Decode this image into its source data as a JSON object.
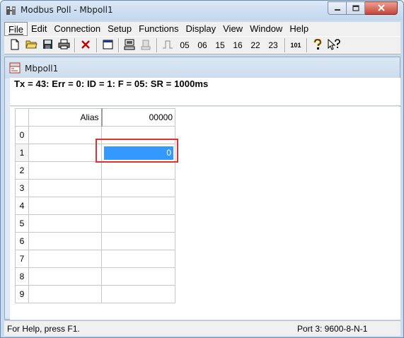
{
  "window": {
    "title": "Modbus Poll - Mbpoll1"
  },
  "menu": [
    {
      "label": "File",
      "accel": "F"
    },
    {
      "label": "Edit",
      "accel": "E"
    },
    {
      "label": "Connection",
      "accel": "C"
    },
    {
      "label": "Setup",
      "accel": "S"
    },
    {
      "label": "Functions",
      "accel": "F"
    },
    {
      "label": "Display",
      "accel": "D"
    },
    {
      "label": "View",
      "accel": "V"
    },
    {
      "label": "Window",
      "accel": "W"
    },
    {
      "label": "Help",
      "accel": "H"
    }
  ],
  "toolbar": {
    "icons": [
      "new-file-icon",
      "open-folder-icon",
      "save-icon",
      "print-icon",
      "delete-x-icon",
      "window-icon",
      "connect-icon",
      "disconnect-icon",
      "pulse-icon"
    ],
    "function_codes": [
      "05",
      "06",
      "15",
      "16",
      "22",
      "23"
    ],
    "code_101": "101"
  },
  "child": {
    "title": "Mbpoll1",
    "status_line": "Tx = 43: Err = 0: ID = 1: F = 05: SR = 1000ms"
  },
  "grid": {
    "header_alias": "Alias",
    "header_value": "00000",
    "rows": [
      {
        "index": "0",
        "alias": "",
        "value": ""
      },
      {
        "index": "1",
        "alias": "",
        "value": "0"
      },
      {
        "index": "2",
        "alias": "",
        "value": ""
      },
      {
        "index": "3",
        "alias": "",
        "value": ""
      },
      {
        "index": "4",
        "alias": "",
        "value": ""
      },
      {
        "index": "5",
        "alias": "",
        "value": ""
      },
      {
        "index": "6",
        "alias": "",
        "value": ""
      },
      {
        "index": "7",
        "alias": "",
        "value": ""
      },
      {
        "index": "8",
        "alias": "",
        "value": ""
      },
      {
        "index": "9",
        "alias": "",
        "value": ""
      }
    ],
    "selected_row": 1
  },
  "statusbar": {
    "help": "For Help, press F1.",
    "port": "Port 3: 9600-8-N-1"
  },
  "colors": {
    "selection": "#3399ff",
    "highlight_box": "#e03030"
  }
}
